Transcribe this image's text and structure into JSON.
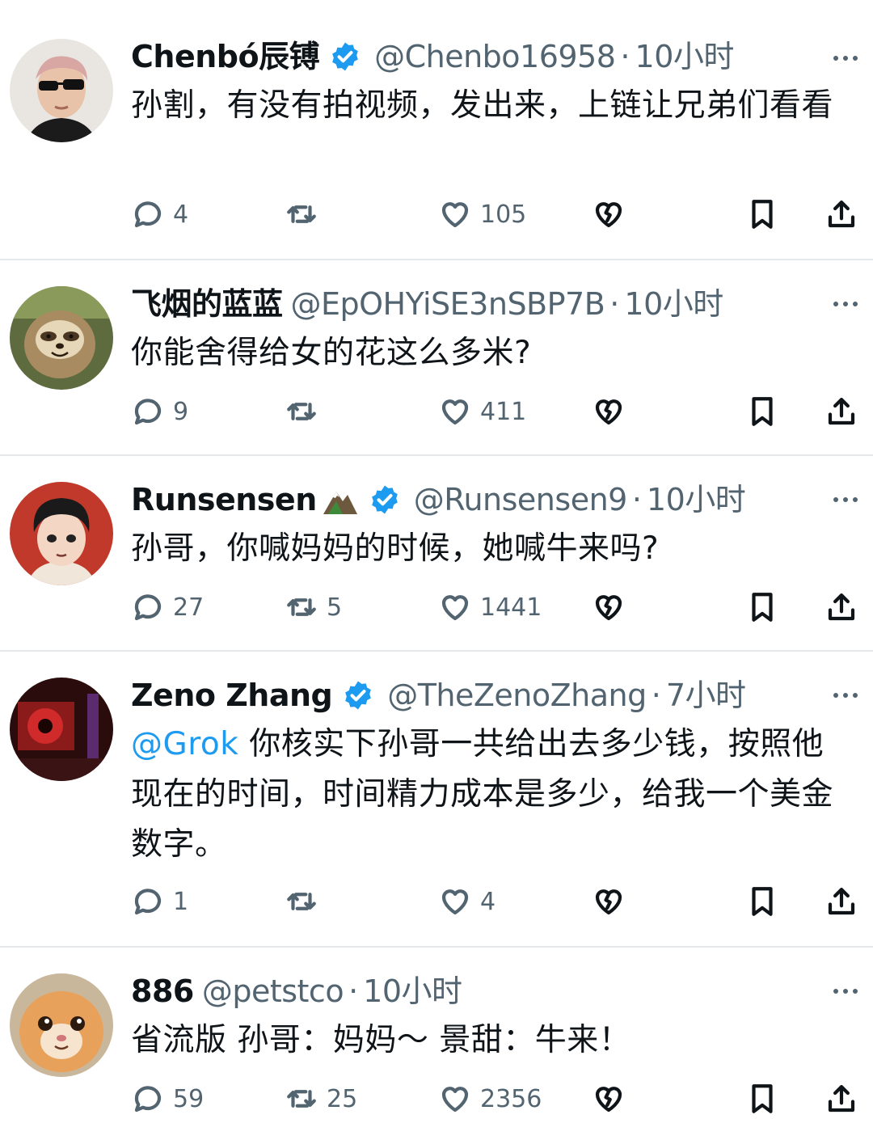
{
  "colors": {
    "accent": "#1d9bf0",
    "text": "#0f1419",
    "secondary": "#536471",
    "divider": "#e6e9ec"
  },
  "tweets": [
    {
      "name": "Chenbó辰镈",
      "verified": true,
      "handle": "@Chenbo16958",
      "time": "10小时",
      "text": "孙割，有没有拍视频，发出来，上链让兄弟们看看",
      "replies": "4",
      "retweets": "",
      "likes": "105"
    },
    {
      "name": "飞烟的蓝蓝",
      "verified": false,
      "handle": "@EpOHYiSE3nSBP7B",
      "time": "10小时",
      "text": "你能舍得给女的花这么多米?",
      "replies": "9",
      "retweets": "",
      "likes": "411"
    },
    {
      "name": "Runsensen",
      "verified": true,
      "emoji": "mountain-icon",
      "handle": "@Runsensen9",
      "time": "10小时",
      "text": "孙哥，你喊妈妈的时候，她喊牛来吗?",
      "replies": "27",
      "retweets": "5",
      "likes": "1441"
    },
    {
      "name": "Zeno Zhang",
      "verified": true,
      "handle": "@TheZenoZhang",
      "time": "7小时",
      "mention": "@Grok",
      "text": " 你核实下孙哥一共给出去多少钱，按照他现在的时间，时间精力成本是多少，给我一个美金数字。",
      "replies": "1",
      "retweets": "",
      "likes": "4"
    },
    {
      "name": "886",
      "verified": false,
      "handle": "@petstco",
      "time": "10小时",
      "text": "省流版 孙哥：妈妈～ 景甜：牛来！",
      "replies": "59",
      "retweets": "25",
      "likes": "2356"
    }
  ]
}
